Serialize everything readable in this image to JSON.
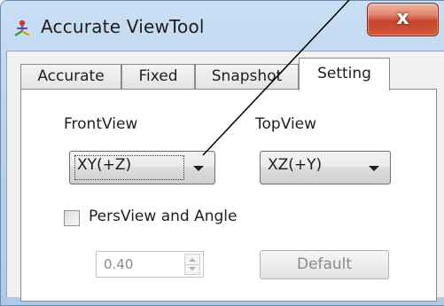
{
  "window": {
    "title": "Accurate ViewTool",
    "close_label": "x"
  },
  "tabs": [
    {
      "label": "Accurate",
      "active": false
    },
    {
      "label": "Fixed",
      "active": false
    },
    {
      "label": "Snapshot",
      "active": false
    },
    {
      "label": "Setting",
      "active": true
    }
  ],
  "setting": {
    "front_view_label": "FrontView",
    "top_view_label": "TopView",
    "front_view_value": "XY(+Z)",
    "top_view_value": "XZ(+Y)",
    "pers_view_label": "PersView and Angle",
    "pers_view_checked": false,
    "angle_value": "0.40",
    "default_label": "Default"
  },
  "icons": {
    "app": "app-icon",
    "dropdown": "chevron-down-icon",
    "spin_up": "spin-up-icon",
    "spin_down": "spin-down-icon"
  },
  "colors": {
    "close_button": "#c6432a",
    "title_bar": "#bad3ec",
    "panel": "#ffffff",
    "disabled_text": "#8a8a8a"
  }
}
